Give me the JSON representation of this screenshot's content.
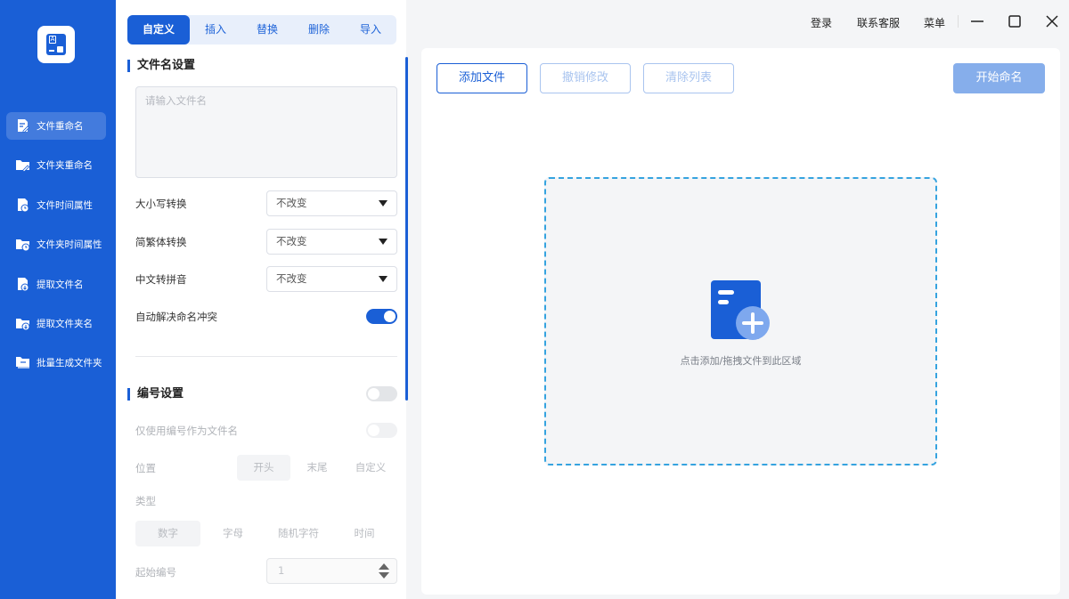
{
  "sidebar": {
    "items": [
      {
        "label": "文件重命名",
        "icon": "file-edit-icon",
        "active": true
      },
      {
        "label": "文件夹重命名",
        "icon": "folder-edit-icon",
        "active": false
      },
      {
        "label": "文件时间属性",
        "icon": "file-clock-icon",
        "active": false
      },
      {
        "label": "文件夹时间属性",
        "icon": "folder-clock-icon",
        "active": false
      },
      {
        "label": "提取文件名",
        "icon": "file-extract-icon",
        "active": false
      },
      {
        "label": "提取文件夹名",
        "icon": "folder-extract-icon",
        "active": false
      },
      {
        "label": "批量生成文件夹",
        "icon": "folder-batch-icon",
        "active": false
      }
    ]
  },
  "tabs": [
    "自定义",
    "插入",
    "替换",
    "删除",
    "导入"
  ],
  "filename": {
    "title": "文件名设置",
    "placeholder": "请输入文件名",
    "case_label": "大小写转换",
    "case_value": "不改变",
    "simp_label": "简繁体转换",
    "simp_value": "不改变",
    "pinyin_label": "中文转拼音",
    "pinyin_value": "不改变",
    "conflict_label": "自动解决命名冲突",
    "conflict_on": true
  },
  "numbering": {
    "title": "编号设置",
    "enabled": false,
    "only_label": "仅使用编号作为文件名",
    "position_label": "位置",
    "positions": [
      "开头",
      "末尾",
      "自定义"
    ],
    "type_label": "类型",
    "types": [
      "数字",
      "字母",
      "随机字符",
      "时间"
    ],
    "start_label": "起始编号",
    "start_value": "1"
  },
  "topbar": {
    "login": "登录",
    "contact": "联系客服",
    "menu": "菜单"
  },
  "main": {
    "add_files": "添加文件",
    "undo": "撤销修改",
    "clear": "清除列表",
    "start": "开始命名",
    "drop_hint": "点击添加/拖拽文件到此区域"
  },
  "colors": {
    "brand": "#1a5fd6",
    "dropzone_border": "#35a3df"
  }
}
